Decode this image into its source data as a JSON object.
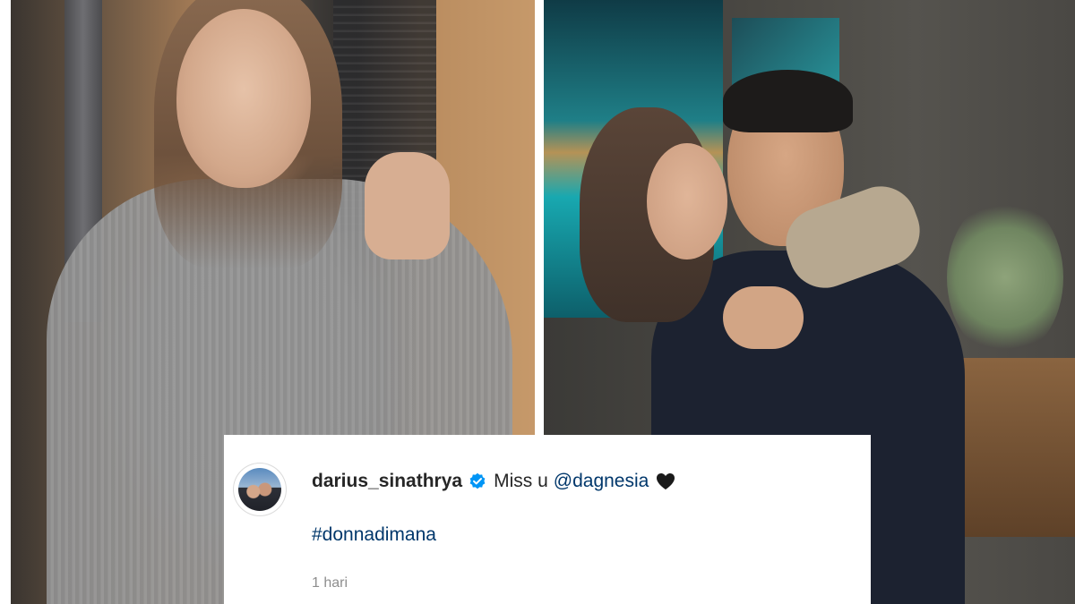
{
  "post": {
    "username": "darius_sinathrya",
    "caption": "Miss u",
    "mention": "@dagnesia",
    "hashtag": "#donnadimana",
    "timestamp": "1 hari"
  },
  "icons": {
    "verified": "verified-badge-icon",
    "heart": "black-heart-icon"
  },
  "colors": {
    "text": "#262626",
    "link": "#00376b",
    "verified": "#0095f6",
    "timestamp": "#8e8e8e"
  }
}
